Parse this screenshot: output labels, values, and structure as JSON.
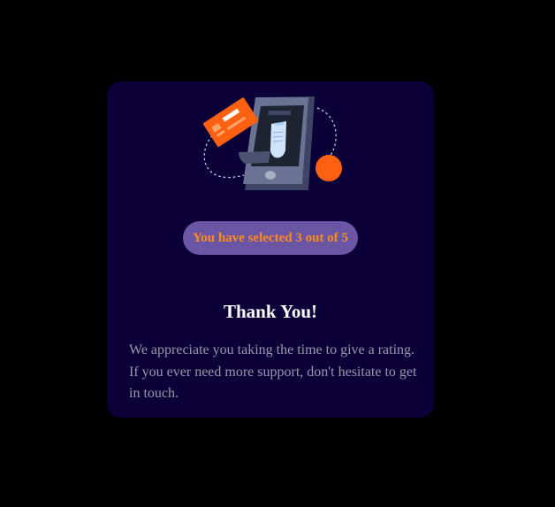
{
  "card": {
    "illustration_icon": "phone-payment-receipt-illustration",
    "selection_text": "You have selected 3 out of 5",
    "selected_rating": 3,
    "max_rating": 5,
    "title": "Thank You!",
    "message": "We appreciate you taking the time to give a rating. If you ever need more support, don't hesitate to get in touch."
  },
  "colors": {
    "page_background": "#000000",
    "card_background": "#0c0039",
    "badge_background": "#6a56a5",
    "accent_orange": "#ff6111",
    "badge_text": "#ff8c1a",
    "title_text": "#ffffff",
    "body_text": "#9a97a8"
  }
}
